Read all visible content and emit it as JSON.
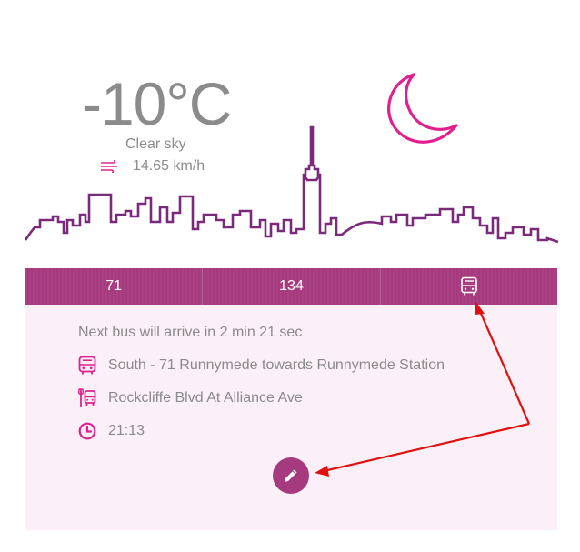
{
  "weather": {
    "temperature": "-10°C",
    "condition": "Clear sky",
    "wind_speed": "14.65 km/h",
    "wind_icon": "wind-icon",
    "sky_icon": "moon-icon"
  },
  "tabs": [
    {
      "label": "71"
    },
    {
      "label": "134"
    },
    {
      "icon": "bus-icon"
    }
  ],
  "panel": {
    "arrival_text": "Next bus will arrive in 2 min 21 sec",
    "route": "South - 71 Runnymede towards Runnymede Station",
    "stop": "Rockcliffe Blvd At Alliance Ave",
    "time": "21:13",
    "route_icon": "bus-icon",
    "stop_icon": "bus-stop-icon",
    "time_icon": "clock-icon",
    "edit_icon": "pencil-icon"
  },
  "colors": {
    "accent": "#a53a7e",
    "moon": "#e0208f",
    "skyline": "#7b2a7b",
    "panel_bg": "#fbf0f7",
    "annotation": "#e01010"
  }
}
